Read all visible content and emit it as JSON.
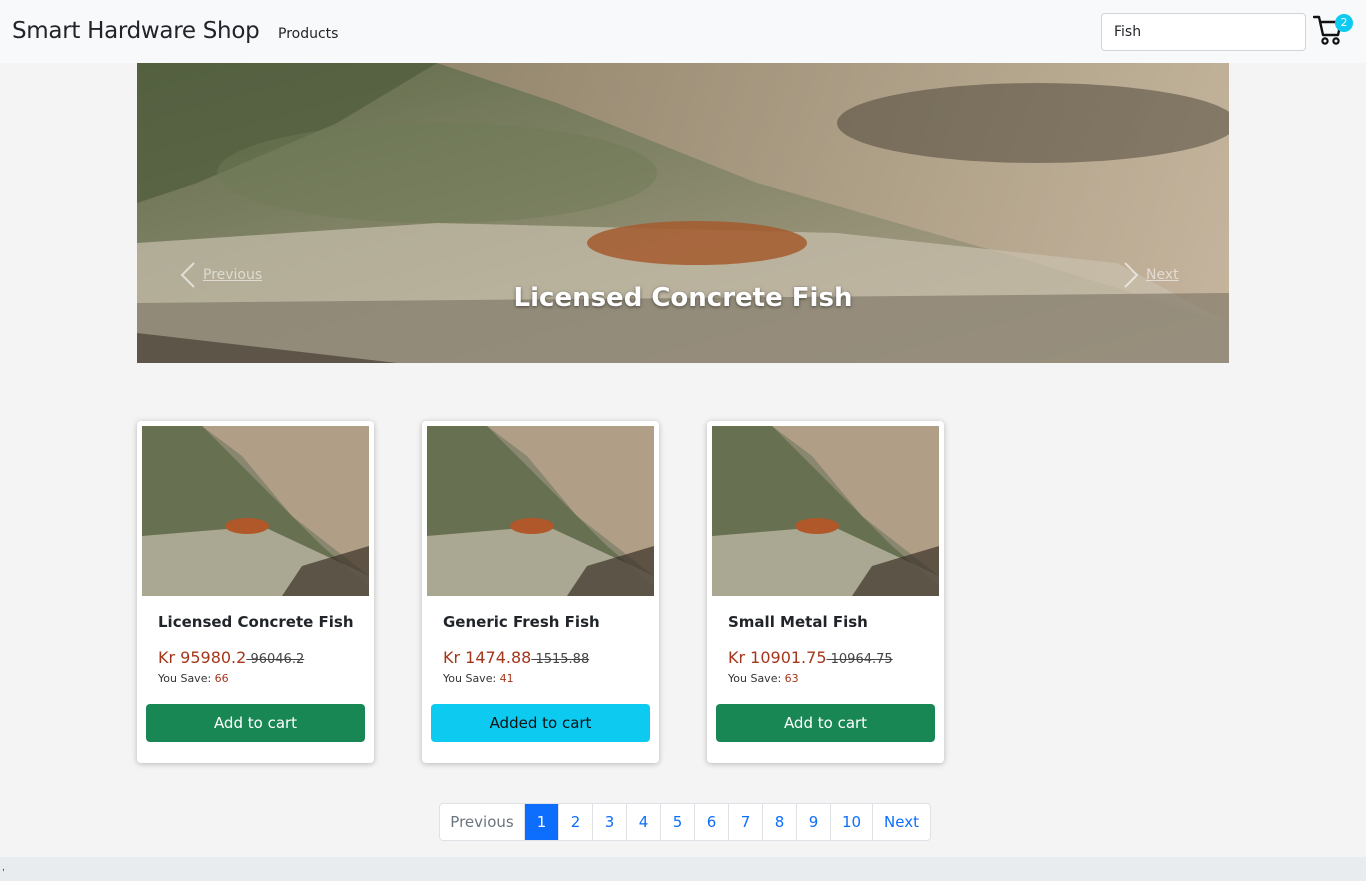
{
  "navbar": {
    "brand": "Smart Hardware Shop",
    "products_link": "Products",
    "search_value": "Fish",
    "cart_count": "2"
  },
  "carousel": {
    "prev_label": "Previous",
    "next_label": "Next",
    "caption": "Licensed Concrete Fish"
  },
  "products": [
    {
      "name": "Licensed Concrete Fish",
      "price": "Kr 95980.2",
      "old_price": " 96046.2",
      "save_label": "You Save: ",
      "save_value": "66",
      "button": "Add to cart"
    },
    {
      "name": "Generic Fresh Fish",
      "price": "Kr 1474.88",
      "old_price": " 1515.88",
      "save_label": "You Save: ",
      "save_value": "41",
      "button": "Added to cart"
    },
    {
      "name": "Small Metal Fish",
      "price": "Kr 10901.75",
      "old_price": " 10964.75",
      "save_label": "You Save: ",
      "save_value": "63",
      "button": "Add to cart"
    }
  ],
  "pagination": {
    "previous": "Previous",
    "pages": [
      "1",
      "2",
      "3",
      "4",
      "5",
      "6",
      "7",
      "8",
      "9",
      "10"
    ],
    "next": "Next",
    "active_page": "1"
  },
  "footer": {
    "mark": ","
  },
  "colors": {
    "primary": "#0d6efd",
    "success": "#198754",
    "info": "#0dcaf0",
    "price": "#a5361b"
  }
}
